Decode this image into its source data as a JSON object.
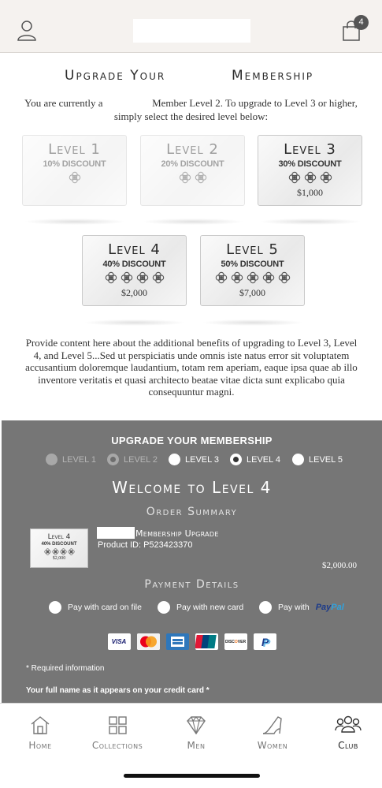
{
  "header": {
    "cart_count": "4"
  },
  "page": {
    "title_part1": "Upgrade Your",
    "title_part2": "Membership",
    "intro_line1_a": "You are currently a",
    "intro_line1_b": "Member Level 2. To upgrade to Level 3 or higher,",
    "intro_line2": "simply select the desired level below:",
    "benefits_text": "Provide content here about the additional benefits of upgrading to Level 3, Level 4, and Level 5...Sed ut perspiciatis unde omnis iste natus error sit voluptatem accusantium doloremque laudantium, totam rem aperiam, eaque ipsa quae ab illo inventore veritatis et quasi architecto beatae vitae dicta sunt explicabo quia consequuntur magni."
  },
  "levels": [
    {
      "label": "Level 1",
      "discount": "10% DISCOUNT",
      "knots": 1,
      "price": "",
      "state": "disabled"
    },
    {
      "label": "Level 2",
      "discount": "20% DISCOUNT",
      "knots": 2,
      "price": "",
      "state": "disabled"
    },
    {
      "label": "Level 3",
      "discount": "30% DISCOUNT",
      "knots": 3,
      "price": "$1,000",
      "state": "available"
    },
    {
      "label": "Level 4",
      "discount": "40% DISCOUNT",
      "knots": 4,
      "price": "$2,000",
      "state": "available"
    },
    {
      "label": "Level 5",
      "discount": "50% DISCOUNT",
      "knots": 5,
      "price": "$7,000",
      "state": "available"
    }
  ],
  "upgrade_panel": {
    "heading": "UPGRADE YOUR MEMBERSHIP",
    "radio_options": [
      {
        "label": "LEVEL 1",
        "disabled": true,
        "selected": false
      },
      {
        "label": "LEVEL 2",
        "disabled": true,
        "selected": true
      },
      {
        "label": "LEVEL 3",
        "disabled": false,
        "selected": false
      },
      {
        "label": "LEVEL 4",
        "disabled": false,
        "selected": true
      },
      {
        "label": "LEVEL 5",
        "disabled": false,
        "selected": false
      }
    ],
    "welcome": "Welcome to Level 4",
    "order_summary_title": "Order Summary",
    "mini_card": {
      "label": "Level 4",
      "discount": "40% DISCOUNT",
      "price": "$2,000"
    },
    "product_name": "Membership Upgrade",
    "product_id": "Product ID: P523423370",
    "product_price": "$2,000.00",
    "payment_title": "Payment Details",
    "payment_options": {
      "card_on_file": "Pay with card on file",
      "new_card": "Pay with new card",
      "pay_with": "Pay with",
      "paypal_a": "Pay",
      "paypal_b": "Pal"
    },
    "card_logos": [
      "VISA",
      "MasterCard",
      "American Express",
      "UnionPay",
      "DISCOVER",
      "PayPal"
    ],
    "required_note": "* Required information",
    "fullname_label": "Your full name as it appears on your credit card *"
  },
  "bottom_nav": [
    {
      "label": "Home",
      "icon": "home-icon",
      "active": false
    },
    {
      "label": "Collections",
      "icon": "grid-icon",
      "active": false
    },
    {
      "label": "Men",
      "icon": "diamond-icon",
      "active": false
    },
    {
      "label": "Women",
      "icon": "heel-icon",
      "active": false
    },
    {
      "label": "Club",
      "icon": "group-icon",
      "active": true
    }
  ],
  "colors": {
    "panel_gray": "#767676",
    "header_bg": "#f5f2ef",
    "paypal_dark": "#1b3a8a",
    "paypal_light": "#2fa3e0"
  }
}
